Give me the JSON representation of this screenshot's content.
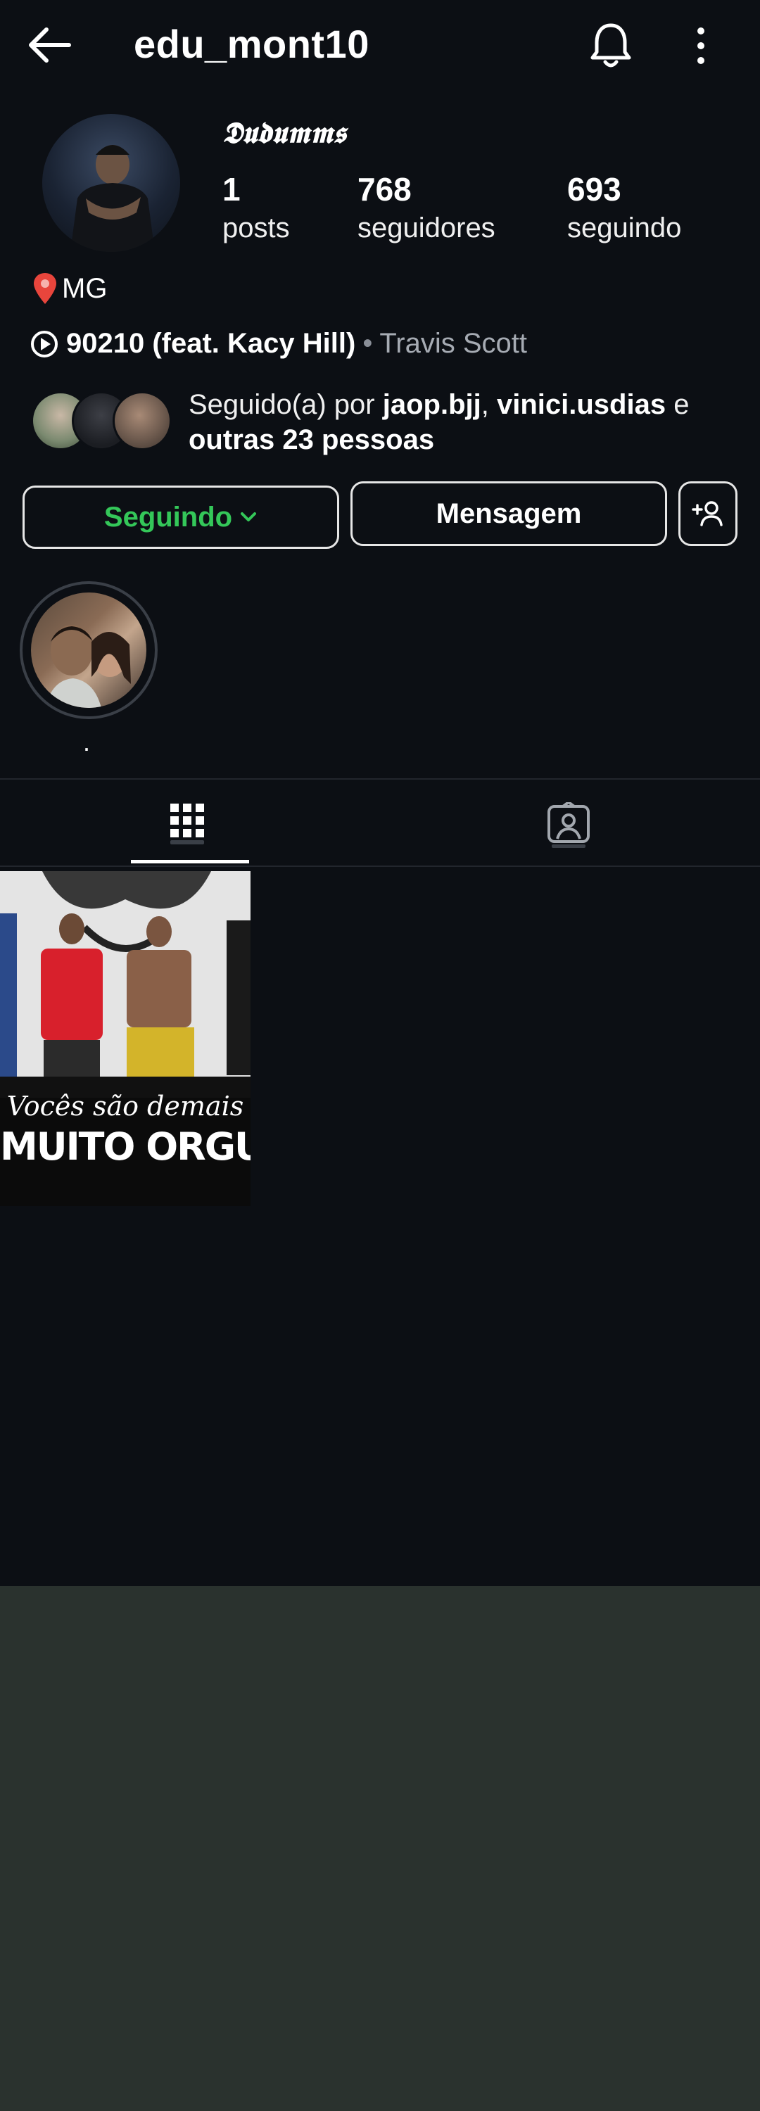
{
  "header": {
    "username": "edu_mont10",
    "back_icon": "arrow-left-icon",
    "bell_icon": "bell-icon",
    "more_icon": "more-vertical-icon"
  },
  "profile": {
    "display_name": "𝕯𝖚𝖉𝖚𝖒𝖒𝖘",
    "stats": [
      {
        "value": "1",
        "label": "posts"
      },
      {
        "value": "768",
        "label": "seguidores"
      },
      {
        "value": "693",
        "label": "seguindo"
      }
    ],
    "location": "MG",
    "music": {
      "song": "90210 (feat. Kacy Hill)",
      "separator": "•",
      "artist": "Travis Scott"
    },
    "followed_by": {
      "prefix": "Seguido(a) por ",
      "user1": "jaop.bjj",
      "comma": ", ",
      "user2": "vinici.usdias",
      "and": " e",
      "others": "outras 23 pessoas"
    }
  },
  "actions": {
    "following_label": "Seguindo",
    "message_label": "Mensagem",
    "add_user_icon": "add-user-icon"
  },
  "highlights": [
    {
      "label": "."
    }
  ],
  "tabs": [
    {
      "name": "grid",
      "icon": "grid-icon",
      "active": true
    },
    {
      "name": "tagged",
      "icon": "tagged-icon",
      "active": false
    }
  ],
  "posts": [
    {
      "overlay_line1": "Vocês são demais",
      "overlay_line2": "MUITO ORGULHO"
    }
  ],
  "colors": {
    "background": "#0c0f14",
    "following_green": "#34c759",
    "bottom_area": "#2a322e"
  }
}
